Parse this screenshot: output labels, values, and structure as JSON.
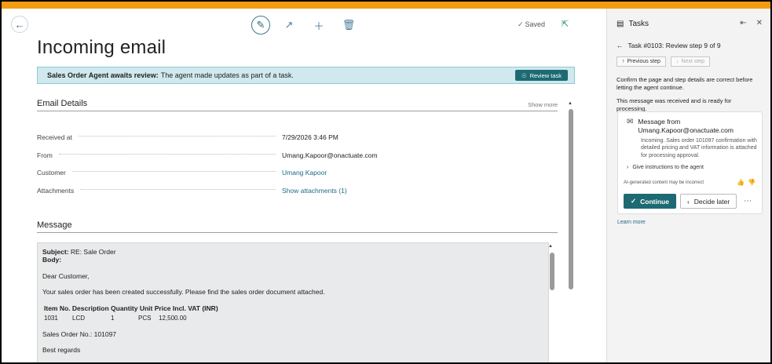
{
  "header": {
    "saved_label": "Saved",
    "page_title": "Incoming email"
  },
  "banner": {
    "prefix": "Sales Order Agent awaits review:",
    "text": "The agent made updates as part of a task.",
    "button_label": "Review task"
  },
  "email_details": {
    "heading": "Email Details",
    "show_more": "Show more",
    "fields": [
      {
        "label": "Received at",
        "value": "7/29/2026 3:46 PM"
      },
      {
        "label": "From",
        "value": "Umang.Kapoor@onactuate.com"
      },
      {
        "label": "Customer",
        "value": "Umang Kapoor"
      },
      {
        "label": "Attachments",
        "value": "Show attachments (1)"
      }
    ]
  },
  "message": {
    "heading": "Message",
    "subject_label": "Subject:",
    "subject": "RE: Sale Order",
    "body_label": "Body:",
    "greeting": "Dear Customer,",
    "line1": "Your sales order has been created successfully. Please find the sales order document attached.",
    "table_header": "Item No. Description Quantity Unit Price Incl. VAT (INR)",
    "row": {
      "item": "1031",
      "desc": "LCD",
      "qty": "1",
      "unit": "PCS",
      "price": "12,500.00"
    },
    "order_no": "Sales Order No.: 101097",
    "closing": "Best regards"
  },
  "pane": {
    "title": "Tasks",
    "step_title": "Task #0103: Review step 9 of 9",
    "prev_step": "Previous step",
    "next_step": "Next step",
    "instruction": "Confirm the page and step details are correct before letting the agent continue.",
    "status": "This message was received and is ready for processing.",
    "card": {
      "title_line1": "Message from",
      "title_line2": "Umang.Kapoor@onactuate.com",
      "description": "Incoming. Sales order 101097 confirmation with detailed pricing and VAT information is attached for processing approval.",
      "instructions": "Give instructions to the agent",
      "ai_note": "AI-generated content may be incorrect",
      "continue_label": "Continue",
      "later_label": "Decide later"
    },
    "learn_more": "Learn more"
  },
  "colors": {
    "accent": "#1d6a73",
    "topbar": "#f39c12",
    "banner_bg": "#cfe9ee"
  }
}
